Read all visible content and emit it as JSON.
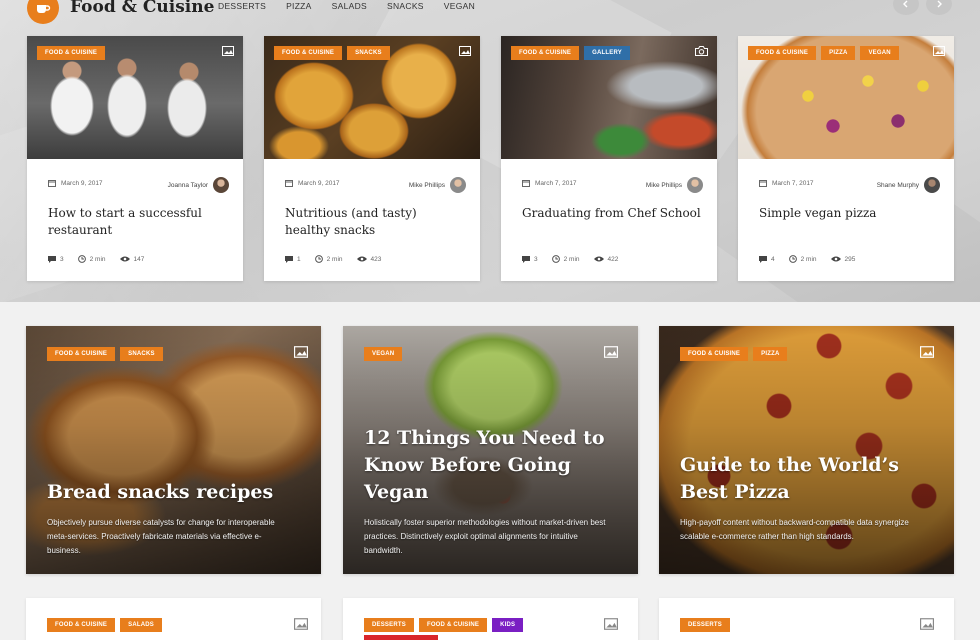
{
  "header": {
    "site_title": "Food & Cuisine",
    "nav": [
      "DESSERTS",
      "PIZZA",
      "SALADS",
      "SNACKS",
      "VEGAN"
    ]
  },
  "top_cards": [
    {
      "tags": [
        "FOOD & CUISINE"
      ],
      "date": "March 9, 2017",
      "author": "Joanna Taylor",
      "title": "How to start a successful restaurant",
      "comments": "3",
      "read_time": "2 min",
      "views": "147",
      "media_icon": "image-icon"
    },
    {
      "tags": [
        "FOOD & CUISINE",
        "SNACKS"
      ],
      "date": "March 9, 2017",
      "author": "Mike Phillips",
      "title": "Nutritious (and tasty) healthy snacks",
      "comments": "1",
      "read_time": "2 min",
      "views": "423",
      "media_icon": "image-icon"
    },
    {
      "tags": [
        "FOOD & CUISINE",
        "GALLERY"
      ],
      "date": "March 7, 2017",
      "author": "Mike Phillips",
      "title": "Graduating from Chef School",
      "comments": "3",
      "read_time": "2 min",
      "views": "422",
      "media_icon": "camera-icon"
    },
    {
      "tags": [
        "FOOD & CUISINE",
        "PIZZA",
        "VEGAN"
      ],
      "date": "March 7, 2017",
      "author": "Shane Murphy",
      "title": "Simple vegan pizza",
      "comments": "4",
      "read_time": "2 min",
      "views": "295",
      "media_icon": "image-icon"
    }
  ],
  "featured": [
    {
      "tags": [
        "FOOD & CUISINE",
        "SNACKS"
      ],
      "title": "Bread snacks recipes",
      "excerpt": "Objectively pursue diverse catalysts for change for interoperable meta-services. Proactively fabricate materials via effective e-business."
    },
    {
      "tags": [
        "VEGAN"
      ],
      "title": "12 Things You Need to Know Before Going Vegan",
      "excerpt": "Holistically foster superior methodologies without market-driven best practices. Distinctively exploit optimal alignments for intuitive bandwidth."
    },
    {
      "tags": [
        "FOOD & CUISINE",
        "PIZZA"
      ],
      "title": "Guide to the World’s Best Pizza",
      "excerpt": "High-payoff content without backward-compatible data synergize scalable e-commerce rather than high standards."
    }
  ],
  "bottom_cards": [
    {
      "tags": [
        "FOOD & CUISINE",
        "SALADS"
      ]
    },
    {
      "tags": [
        "DESSERTS",
        "FOOD & CUISINE",
        "KIDS"
      ]
    },
    {
      "tags": [
        "DESSERTS"
      ]
    }
  ],
  "colors": {
    "accent": "#e87e1c",
    "gallery_tag": "#2f6fa8",
    "kids_tag": "#7a1fc3"
  }
}
